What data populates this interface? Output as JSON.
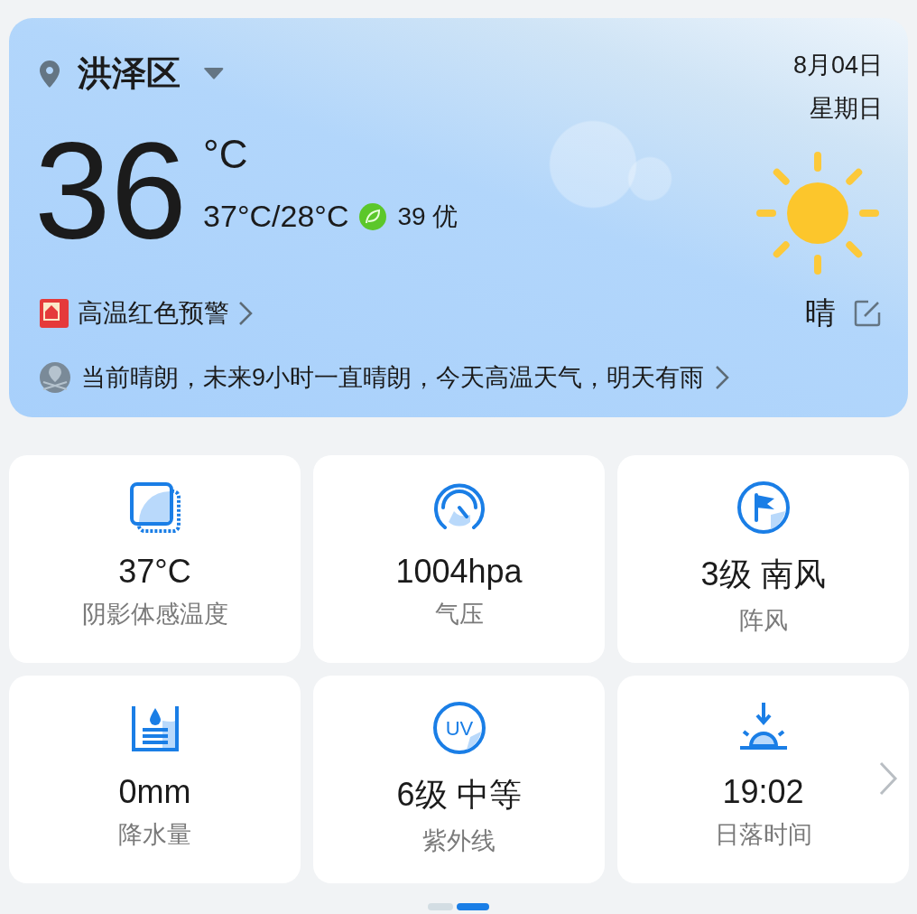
{
  "header": {
    "location": "洪泽区",
    "date": "8月04日",
    "weekday": "星期日"
  },
  "current": {
    "temperature": "36",
    "unit": "°C",
    "range": "37°C/28°C",
    "aqi_value": "39",
    "aqi_label": "优",
    "condition": "晴"
  },
  "alert": {
    "text": "高温红色预警"
  },
  "forecast_summary": "当前晴朗，未来9小时一直晴朗，今天高温天气，明天有雨",
  "tiles": [
    {
      "kind": "shade",
      "value": "37°C",
      "label": "阴影体感温度"
    },
    {
      "kind": "pressure",
      "value": "1004hpa",
      "label": "气压"
    },
    {
      "kind": "wind",
      "value": "3级 南风",
      "label": "阵风"
    },
    {
      "kind": "rain",
      "value": "0mm",
      "label": "降水量"
    },
    {
      "kind": "uv",
      "icon_text": "UV",
      "value": "6级 中等",
      "label": "紫外线"
    },
    {
      "kind": "sunset",
      "value": "19:02",
      "label": "日落时间"
    }
  ],
  "pager": [
    {
      "selected": false
    },
    {
      "selected": true
    }
  ]
}
